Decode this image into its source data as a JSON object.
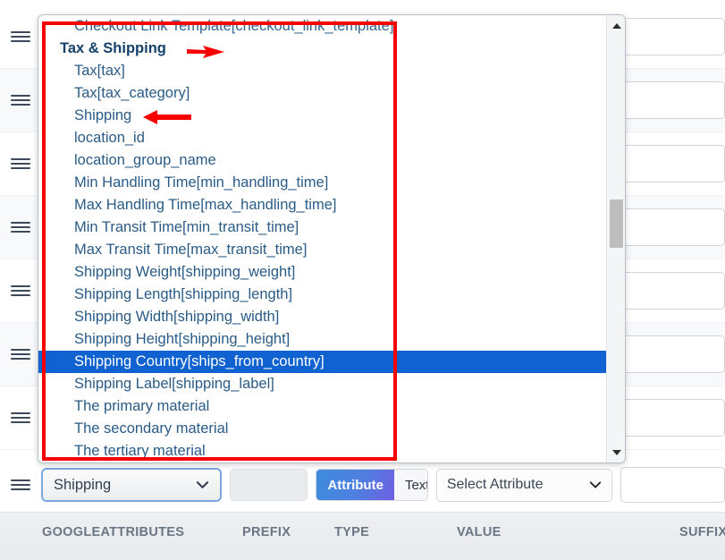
{
  "dropdown": {
    "scroll_up_icon": "triangle-up-icon",
    "scroll_down_icon": "triangle-down-icon",
    "items": [
      {
        "label": "Checkout Link Template[checkout_link_template]",
        "type": "option",
        "selected": false,
        "partial": true
      },
      {
        "label": "Tax & Shipping",
        "type": "group",
        "selected": false
      },
      {
        "label": "Tax[tax]",
        "type": "option",
        "selected": false
      },
      {
        "label": "Tax[tax_category]",
        "type": "option",
        "selected": false
      },
      {
        "label": "Shipping",
        "type": "option",
        "selected": false
      },
      {
        "label": "location_id",
        "type": "option",
        "selected": false
      },
      {
        "label": "location_group_name",
        "type": "option",
        "selected": false
      },
      {
        "label": "Min Handling Time[min_handling_time]",
        "type": "option",
        "selected": false
      },
      {
        "label": "Max Handling Time[max_handling_time]",
        "type": "option",
        "selected": false
      },
      {
        "label": "Min Transit Time[min_transit_time]",
        "type": "option",
        "selected": false
      },
      {
        "label": "Max Transit Time[max_transit_time]",
        "type": "option",
        "selected": false
      },
      {
        "label": "Shipping Weight[shipping_weight]",
        "type": "option",
        "selected": false
      },
      {
        "label": "Shipping Length[shipping_length]",
        "type": "option",
        "selected": false
      },
      {
        "label": "Shipping Width[shipping_width]",
        "type": "option",
        "selected": false
      },
      {
        "label": "Shipping Height[shipping_height]",
        "type": "option",
        "selected": false
      },
      {
        "label": "Shipping Country[ships_from_country]",
        "type": "option",
        "selected": true
      },
      {
        "label": "Shipping Label[shipping_label]",
        "type": "option",
        "selected": false
      },
      {
        "label": "The primary material",
        "type": "option",
        "selected": false
      },
      {
        "label": "The secondary material",
        "type": "option",
        "selected": false
      },
      {
        "label": "The tertiary material",
        "type": "option",
        "selected": false
      }
    ]
  },
  "active_row": {
    "drag_handle_icon": "drag-handle-icon",
    "attribute_select_value": "Shipping",
    "prefix_value": "",
    "toggle_attribute_label": "Attribute",
    "toggle_text_label": "Text",
    "value_select_value": "Select Attribute",
    "suffix_value": "",
    "chevron_icon": "chevron-down-icon"
  },
  "table_header": {
    "columns": [
      "GOOGLEATTRIBUTES",
      "PREFIX",
      "TYPE",
      "VALUE",
      "SUFFIX"
    ]
  },
  "background_rows": [
    {
      "drag_handle_icon": "drag-handle-icon"
    },
    {
      "drag_handle_icon": "drag-handle-icon"
    },
    {
      "drag_handle_icon": "drag-handle-icon"
    },
    {
      "drag_handle_icon": "drag-handle-icon"
    },
    {
      "drag_handle_icon": "drag-handle-icon"
    },
    {
      "drag_handle_icon": "drag-handle-icon"
    },
    {
      "drag_handle_icon": "drag-handle-icon"
    }
  ],
  "annotations": {
    "highlight_color": "#f70000",
    "box_target": "Tax & Shipping option group",
    "arrows": [
      {
        "name": "arrow-to-tax-and-shipping",
        "points_to": "Tax & Shipping"
      },
      {
        "name": "arrow-to-shipping",
        "points_to": "Shipping"
      }
    ]
  },
  "colors": {
    "selected_row": "#0f62d0",
    "option_text": "#2a5b86",
    "group_text": "#14406c",
    "annotation": "#f70000"
  }
}
